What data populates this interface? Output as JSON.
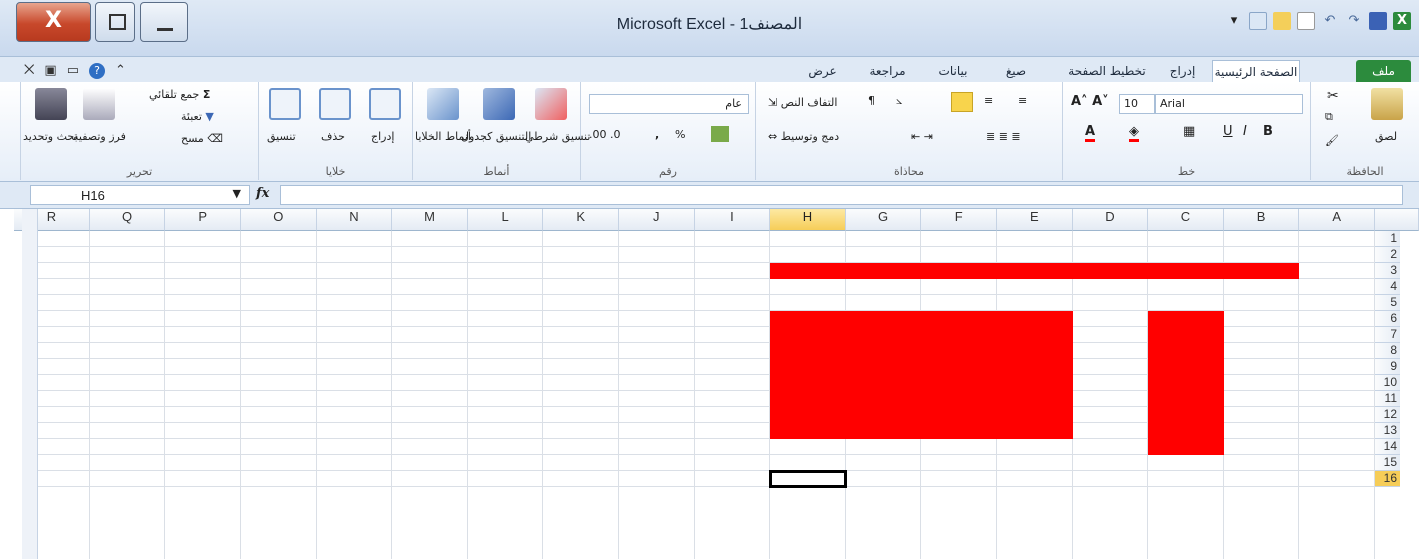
{
  "window": {
    "title": "Microsoft Excel - المصنف1",
    "close_glyph": "X"
  },
  "ribbon_tabs": [
    {
      "label": "ملف",
      "type": "file"
    },
    {
      "label": "الصفحة الرئيسية",
      "type": "active"
    },
    {
      "label": "إدراج"
    },
    {
      "label": "تخطيط الصفحة"
    },
    {
      "label": "صيغ"
    },
    {
      "label": "بيانات"
    },
    {
      "label": "مراجعة"
    },
    {
      "label": "عرض"
    }
  ],
  "groups": {
    "clipboard": {
      "label": "الحافظة",
      "paste": "لصق"
    },
    "font": {
      "label": "خط",
      "font_name": "Arial",
      "font_size": "10"
    },
    "alignment": {
      "label": "محاذاة",
      "wrap_text": "التفاف النص",
      "merge_center": "دمج وتوسيط"
    },
    "number": {
      "label": "رقم",
      "format": "عام"
    },
    "styles": {
      "label": "أنماط",
      "conditional": "تنسيق شرطي",
      "format_table": "التنسيق كجدول",
      "cell_styles": "أنماط الخلايا"
    },
    "cells": {
      "label": "خلايا",
      "insert": "إدراج",
      "delete": "حذف",
      "format": "تنسيق"
    },
    "editing": {
      "label": "تحرير",
      "autosum": "جمع تلقائي",
      "fill": "تعبئة",
      "clear": "مسح",
      "sort_filter": "فرز وتصفية",
      "find_select": "بحث وتحديد"
    }
  },
  "formula_bar": {
    "name_box": "H16",
    "fx_label": "fx",
    "formula": ""
  },
  "sheet": {
    "columns": [
      "A",
      "B",
      "C",
      "D",
      "E",
      "F",
      "G",
      "H",
      "I",
      "J",
      "K",
      "L",
      "M",
      "N",
      "O",
      "P",
      "Q",
      "R"
    ],
    "selected_column": "H",
    "rows": [
      "1",
      "2",
      "3",
      "4",
      "5",
      "6",
      "7",
      "8",
      "9",
      "10",
      "11",
      "12",
      "13",
      "14",
      "15",
      "16"
    ],
    "selected_row": "16",
    "fill_color": "#ff0000"
  }
}
